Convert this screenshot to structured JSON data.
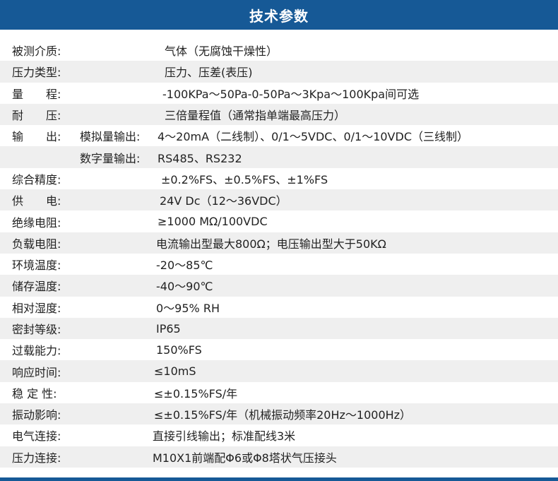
{
  "title": "技术参数",
  "rows": [
    {
      "label": "被测介质:",
      "value": "气体（无腐蚀干燥性）"
    },
    {
      "label": "压力类型:",
      "value": "压力、压差(表压)"
    },
    {
      "label": "量　　程:",
      "value": "-100KPa～50Pa-0-50Pa～3Kpa～100Kpa间可选"
    },
    {
      "label": "耐　　压:",
      "value": "三倍量程值（通常指单端最高压力）"
    },
    {
      "label": "输　　出:",
      "sub": "模拟量输出:",
      "value": "4～20mA（二线制）、0/1～5VDC、0/1～10VDC（三线制）"
    },
    {
      "label": "",
      "sub": "数字量输出:",
      "value": "RS485、RS232"
    },
    {
      "label": "综合精度:",
      "value": "±0.2%FS、±0.5%FS、±1%FS"
    },
    {
      "label": "供　　电:",
      "value": "24V Dc（12～36VDC）"
    },
    {
      "label": "绝缘电阻:",
      "value": "≥1000 MΩ/100VDC"
    },
    {
      "label": "负载电阻:",
      "value": "电流输出型最大800Ω；电压输出型大于50KΩ"
    },
    {
      "label": "环境温度:",
      "value": "-20～85℃"
    },
    {
      "label": "储存温度:",
      "value": "-40～90℃"
    },
    {
      "label": "相对湿度:",
      "value": "0～95% RH"
    },
    {
      "label": "密封等级:",
      "value": "IP65"
    },
    {
      "label": "过载能力:",
      "value": "150%FS"
    },
    {
      "label": "响应时间:",
      "value": "≤10mS"
    },
    {
      "label": "稳 定 性:",
      "value": "≤±0.15%FS/年"
    },
    {
      "label": "振动影响:",
      "value": "≤±0.15%FS/年（机械振动频率20Hz～1000Hz）"
    },
    {
      "label": "电气连接:",
      "value": "直接引线输出；标准配线3米"
    },
    {
      "label": "压力连接:",
      "value": "M10X1前端配Φ6或Φ8塔状气压接头"
    }
  ]
}
